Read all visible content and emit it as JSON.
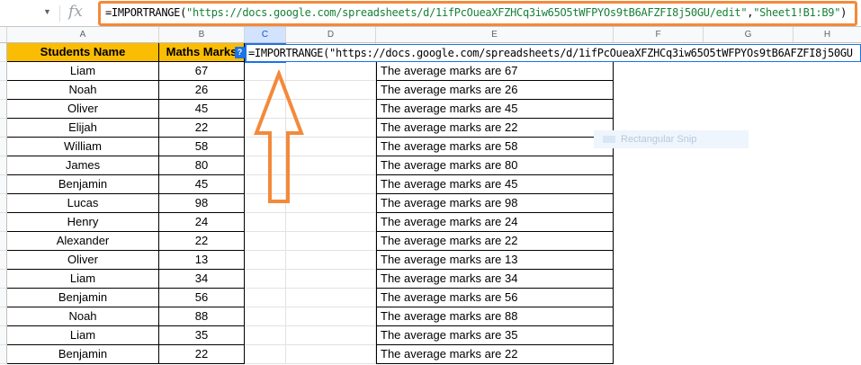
{
  "formula_bar": {
    "fx_label": "fx",
    "formula_prefix": "=IMPORTRANGE(",
    "formula_url": "\"https://docs.google.com/spreadsheets/d/1ifPcOueaXFZHCq3iw65O5tWFPYOs9tB6AFZFI8j50GU/edit\"",
    "formula_comma": ",",
    "formula_range": "\"Sheet1!B1:B9\"",
    "formula_suffix": ")"
  },
  "columns": [
    "A",
    "B",
    "C",
    "D",
    "E",
    "F",
    "G",
    "H"
  ],
  "table": {
    "headers": [
      "Students Name",
      "Maths Marks"
    ],
    "rows": [
      {
        "name": "Liam",
        "marks": "67",
        "text": "The average marks are 67"
      },
      {
        "name": "Noah",
        "marks": "26",
        "text": "The average marks are 26"
      },
      {
        "name": "Oliver",
        "marks": "45",
        "text": "The average marks are 45"
      },
      {
        "name": "Elijah",
        "marks": "22",
        "text": "The average marks are 22"
      },
      {
        "name": "William",
        "marks": "58",
        "text": "The average marks are 58"
      },
      {
        "name": "James",
        "marks": "80",
        "text": "The average marks are 80"
      },
      {
        "name": "Benjamin",
        "marks": "45",
        "text": "The average marks are 45"
      },
      {
        "name": "Lucas",
        "marks": "98",
        "text": "The average marks are 98"
      },
      {
        "name": "Henry",
        "marks": "24",
        "text": "The average marks are 24"
      },
      {
        "name": "Alexander",
        "marks": "22",
        "text": "The average marks are 22"
      },
      {
        "name": "Oliver",
        "marks": "13",
        "text": "The average marks are 13"
      },
      {
        "name": "Liam",
        "marks": "34",
        "text": "The average marks are 34"
      },
      {
        "name": "Benjamin",
        "marks": "56",
        "text": "The average marks are 56"
      },
      {
        "name": "Noah",
        "marks": "88",
        "text": "The average marks are 88"
      },
      {
        "name": "Liam",
        "marks": "35",
        "text": "The average marks are 35"
      },
      {
        "name": "Benjamin",
        "marks": "22",
        "text": "The average marks are 22"
      }
    ]
  },
  "editor": {
    "text": "=IMPORTRANGE(\"https://docs.google.com/spreadsheets/d/1ifPcOueaXFZHCq3iw65O5tWFPYOs9tB6AFZFI8j50GU",
    "help_label": "?"
  },
  "snip_ghost": {
    "label": "Rectangular Snip"
  },
  "colors": {
    "header_fill": "#fbbc04",
    "highlight_orange": "#f4893b",
    "selection_blue": "#1a73e8",
    "string_green": "#188038"
  }
}
